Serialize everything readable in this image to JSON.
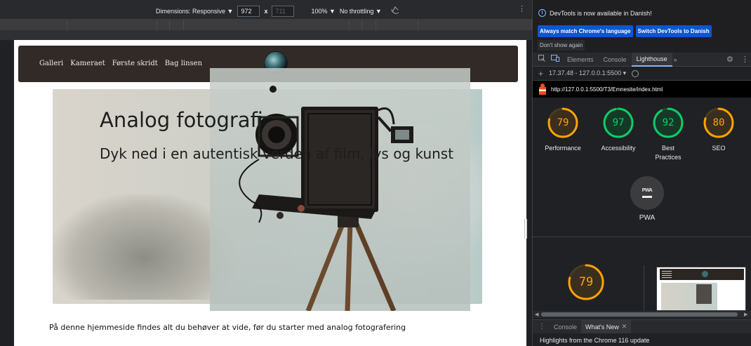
{
  "device_toolbar": {
    "dimensions_label": "Dimensions: Responsive ▼",
    "width": "972",
    "times": "x",
    "height": "711",
    "zoom": "100% ▼",
    "throttling": "No throttling ▼",
    "menu": "⋮"
  },
  "site": {
    "nav": [
      "Galleri",
      "Kameraet",
      "Første skridt",
      "Bag linsen"
    ],
    "hero_title": "Analog fotografi",
    "hero_subtitle": "Dyk ned i en autentisk verden af film, lys og kunst",
    "body_text": "På denne hjemmeside findes alt du behøver at vide, før du starter med analog fotografering"
  },
  "devtools": {
    "info": {
      "message": "DevTools is now available in Danish!",
      "btn_match": "Always match Chrome's language",
      "btn_switch": "Switch DevTools to Danish",
      "dont_show": "Don't show again"
    },
    "tabs": {
      "elements": "Elements",
      "console": "Console",
      "lighthouse": "Lighthouse",
      "more": "»"
    },
    "lighthouse_bar": {
      "report": "17.37.48 - 127.0.0.1:5500 ▾"
    },
    "url": "http://127.0.0.1:5500/T3/Emnesite/index.html",
    "scores": [
      {
        "label": "Performance",
        "value": "79",
        "score": 79,
        "color": "#ffa400"
      },
      {
        "label": "Accessibility",
        "value": "97",
        "score": 97,
        "color": "#0cce6b"
      },
      {
        "label": "Best Practices",
        "value": "92",
        "score": 92,
        "color": "#0cce6b"
      },
      {
        "label": "SEO",
        "value": "80",
        "score": 80,
        "color": "#ffa400"
      }
    ],
    "pwa": {
      "badge": "PWA",
      "label": "PWA"
    },
    "perf_score": {
      "value": "79",
      "score": 79,
      "color": "#ffa400"
    },
    "drawer": {
      "console": "Console",
      "whats_new": "What's New",
      "close": "✕",
      "highlights": "Highlights from the Chrome 116 update"
    }
  }
}
